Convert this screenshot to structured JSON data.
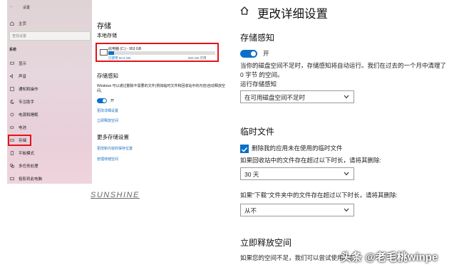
{
  "left_panel": {
    "window_title": "设置",
    "home": "主页",
    "search_placeholder": "查找设置",
    "section": "系统",
    "nav_items": [
      "显示",
      "声音",
      "通知和操作",
      "专注助手",
      "电源和睡眠",
      "电池",
      "存储",
      "平板模式",
      "多任务处理",
      "投影到此电脑"
    ]
  },
  "middle_panel": {
    "title": "存储",
    "local_storage": "本地存储",
    "drive_name": "此电脑 (C:) - 953 GB",
    "used": "已使用 50.6 GB",
    "free": "903 GB 可用",
    "storage_sense": "存储感知",
    "storage_sense_desc": "Windows 可以通过删除不需要的文件(例如临时文件和回收站中的内容)自动释放空间。",
    "toggle_label": "开",
    "link_change": "更改详细设置",
    "link_free_now": "立即释放空间",
    "more_settings": "更多存储设置",
    "link_change_save": "更改新内容的保存位置",
    "link_manage": "管理存储空间"
  },
  "right_panel": {
    "title": "更改详细设置",
    "storage_sense": "存储感知",
    "toggle_label": "开",
    "desc": "当你的磁盘空间不足时，存储感知将自动运行。我们在过去的一个月中清理了 0 字节 的空间。",
    "run_label": "运行存储感知",
    "run_value": "在可用磁盘空间不足时",
    "temp_heading": "临时文件",
    "checkbox_label": "删除我的应用未在使用的临时文件",
    "recycle_label": "如果回收站中的文件存在超过以下时长，请将其删除:",
    "recycle_value": "30 天",
    "downloads_label": "如果\"下载\"文件夹中的文件存在超过以下时长，请将其删除:",
    "downloads_value": "从不",
    "free_now_heading": "立即释放空间",
    "free_now_desc": "如果您的空间不足，我们可以尝试使用现在"
  },
  "caption": "SUNSHINE",
  "watermark": "头条 @老毛桃winpe",
  "colors": {
    "accent": "#0b6fc7",
    "highlight": "#e0151b"
  }
}
